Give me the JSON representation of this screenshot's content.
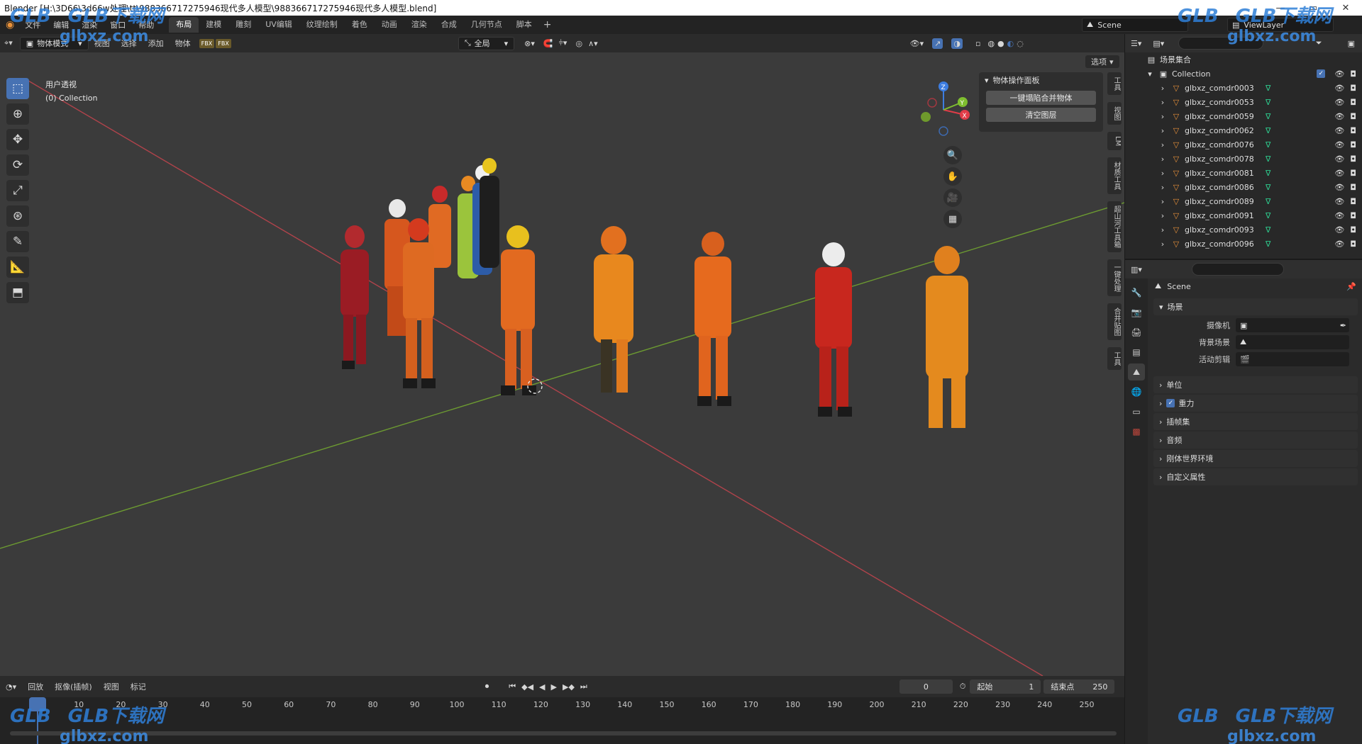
{
  "window": {
    "title": "Blender [H:\\3D66\\3d66w处理\\tt\\988366717275946现代多人模型\\988366717275946现代多人模型.blend]",
    "min": "—",
    "max": "▭",
    "close": "✕"
  },
  "menu": {
    "items": [
      "文件",
      "编辑",
      "渲染",
      "窗口",
      "帮助"
    ],
    "workspaces": [
      "布局",
      "建模",
      "雕刻",
      "UV编辑",
      "纹理绘制",
      "着色",
      "动画",
      "渲染",
      "合成",
      "几何节点",
      "脚本"
    ],
    "active_workspace": 0,
    "add_workspace": "+",
    "scene": "Scene",
    "view_layer": "ViewLayer"
  },
  "viewport_header": {
    "mode": "物体模式",
    "menus": [
      "视图",
      "选择",
      "添加",
      "物体"
    ],
    "transform_orientation": "全局",
    "options": "选项"
  },
  "viewport": {
    "view_name": "用户透视",
    "collection_info": "(0) Collection",
    "tools": [
      "select-box",
      "cursor",
      "move",
      "rotate",
      "scale",
      "transform",
      "annotate",
      "measure",
      "add-cube"
    ],
    "active_tool": 0,
    "gizmo": {
      "x": "X",
      "y": "Y",
      "z": "Z"
    },
    "nav_buttons": [
      "zoom",
      "pan",
      "camera",
      "grid"
    ],
    "panel": {
      "title": "物体操作面板",
      "buttons": [
        "一键塌陷合并物体",
        "清空图层"
      ]
    },
    "side_tabs": [
      "工具",
      "视图",
      "LM",
      "材质工具",
      "超山河工具箱",
      "一键处理",
      "合并贴图",
      "工具"
    ]
  },
  "timeline": {
    "menus": [
      "回放",
      "抠像(插帧)",
      "视图",
      "标记"
    ],
    "current_frame": "0",
    "start_label": "起始",
    "start": "1",
    "end_label": "结束点",
    "end": "250",
    "ticks": [
      "0",
      "10",
      "20",
      "30",
      "40",
      "50",
      "60",
      "70",
      "80",
      "90",
      "100",
      "110",
      "120",
      "130",
      "140",
      "150",
      "160",
      "170",
      "180",
      "190",
      "200",
      "210",
      "220",
      "230",
      "240",
      "250"
    ]
  },
  "outliner": {
    "root": "场景集合",
    "collection": "Collection",
    "objects": [
      "glbxz_comdr0003",
      "glbxz_comdr0053",
      "glbxz_comdr0059",
      "glbxz_comdr0062",
      "glbxz_comdr0076",
      "glbxz_comdr0078",
      "glbxz_comdr0081",
      "glbxz_comdr0086",
      "glbxz_comdr0089",
      "glbxz_comdr0091",
      "glbxz_comdr0093",
      "glbxz_comdr0096"
    ]
  },
  "properties": {
    "context": "Scene",
    "scene_section": "场景",
    "fields": [
      {
        "label": "摄像机",
        "value": ""
      },
      {
        "label": "背景场景",
        "value": ""
      },
      {
        "label": "活动剪辑",
        "value": ""
      }
    ],
    "sections": [
      "单位",
      "重力",
      "插帧集",
      "音频",
      "刚体世界环境",
      "自定义属性"
    ],
    "gravity_checked": true
  },
  "watermark": {
    "brand": "GLB下载网",
    "site": "glbxz.com",
    "logo": "GLB"
  },
  "colors": {
    "accent": "#4772b3",
    "x_axis": "#e03c48",
    "y_axis": "#7fbf2f",
    "z_axis": "#3d7de0",
    "object_icon": "#e8913a"
  }
}
